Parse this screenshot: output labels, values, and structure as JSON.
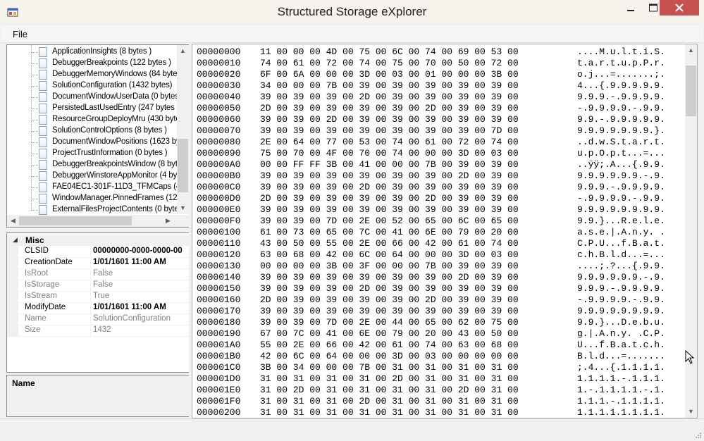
{
  "window": {
    "title": "Structured Storage eXplorer",
    "app_icon": "app-window-icon",
    "controls": [
      "minimize-icon",
      "maximize-icon",
      "close-icon"
    ],
    "close_color": "#c75050"
  },
  "menu": {
    "file": "File"
  },
  "tree": {
    "items": [
      "ApplicationInsights (8 bytes )",
      "DebuggerBreakpoints (122 bytes )",
      "DebuggerMemoryWindows (84 bytes",
      "SolutionConfiguration (1432 bytes)",
      "DocumentWindowUserData (0 bytes",
      "PersistedLastUsedEntry (247 bytes )",
      "ResourceGroupDeployMru (430 byte",
      "SolutionControlOptions (8 bytes )",
      "DocumentWindowPositions (1623 by",
      "ProjectTrustInformation (0 bytes )",
      "DebuggerBreakpointsWindow (8 byt",
      "DebuggerWinstoreAppMonitor (4 byt",
      "FAE04EC1-301F-11D3_TFMCaps (4",
      "WindowManager.PinnedFrames (12",
      "ExternalFilesProjectContents (0 bytes"
    ]
  },
  "properties": {
    "category": "Misc",
    "rows": [
      {
        "name": "CLSID",
        "value": "00000000-0000-0000-00",
        "style": "strong"
      },
      {
        "name": "CreationDate",
        "value": "1/01/1601 11:00 AM",
        "style": "strong"
      },
      {
        "name": "IsRoot",
        "value": "False",
        "style": "muted"
      },
      {
        "name": "IsStorage",
        "value": "False",
        "style": "muted"
      },
      {
        "name": "IsStream",
        "value": "True",
        "style": "muted"
      },
      {
        "name": "ModifyDate",
        "value": "1/01/1601 11:00 AM",
        "style": "strong"
      },
      {
        "name": "Name",
        "value": "SolutionConfiguration",
        "style": "muted"
      },
      {
        "name": "Size",
        "value": "1432",
        "style": "muted"
      }
    ],
    "description_title": "Name"
  },
  "hex": {
    "rows": [
      {
        "offset": "00000000",
        "bytes": "11 00 00 00 4D 00 75 00 6C 00 74 00 69 00 53 00",
        "ascii": "....M.u.l.t.i.S."
      },
      {
        "offset": "00000010",
        "bytes": "74 00 61 00 72 00 74 00 75 00 70 00 50 00 72 00",
        "ascii": "t.a.r.t.u.p.P.r."
      },
      {
        "offset": "00000020",
        "bytes": "6F 00 6A 00 00 00 3D 00 03 00 01 00 00 00 3B 00",
        "ascii": "o.j...=.......;."
      },
      {
        "offset": "00000030",
        "bytes": "34 00 00 00 7B 00 39 00 39 00 39 00 39 00 39 00",
        "ascii": "4...{.9.9.9.9.9."
      },
      {
        "offset": "00000040",
        "bytes": "39 00 39 00 39 00 2D 00 39 00 39 00 39 00 39 00",
        "ascii": "9.9.9.-.9.9.9.9."
      },
      {
        "offset": "00000050",
        "bytes": "2D 00 39 00 39 00 39 00 39 00 2D 00 39 00 39 00",
        "ascii": "-.9.9.9.9.-.9.9."
      },
      {
        "offset": "00000060",
        "bytes": "39 00 39 00 2D 00 39 00 39 00 39 00 39 00 39 00",
        "ascii": "9.9.-.9.9.9.9.9."
      },
      {
        "offset": "00000070",
        "bytes": "39 00 39 00 39 00 39 00 39 00 39 00 39 00 7D 00",
        "ascii": "9.9.9.9.9.9.9.}."
      },
      {
        "offset": "00000080",
        "bytes": "2E 00 64 00 77 00 53 00 74 00 61 00 72 00 74 00",
        "ascii": "..d.w.S.t.a.r.t."
      },
      {
        "offset": "00000090",
        "bytes": "75 00 70 00 4F 00 70 00 74 00 00 00 3D 00 03 00",
        "ascii": "u.p.O.p.t...=..."
      },
      {
        "offset": "000000A0",
        "bytes": "00 00 FF FF 3B 00 41 00 00 00 7B 00 39 00 39 00",
        "ascii": "..ÿÿ;.A...{.9.9."
      },
      {
        "offset": "000000B0",
        "bytes": "39 00 39 00 39 00 39 00 39 00 39 00 2D 00 39 00",
        "ascii": "9.9.9.9.9.9.-.9."
      },
      {
        "offset": "000000C0",
        "bytes": "39 00 39 00 39 00 2D 00 39 00 39 00 39 00 39 00",
        "ascii": "9.9.9.-.9.9.9.9."
      },
      {
        "offset": "000000D0",
        "bytes": "2D 00 39 00 39 00 39 00 39 00 2D 00 39 00 39 00",
        "ascii": "-.9.9.9.9.-.9.9."
      },
      {
        "offset": "000000E0",
        "bytes": "39 00 39 00 39 00 39 00 39 00 39 00 39 00 39 00",
        "ascii": "9.9.9.9.9.9.9.9."
      },
      {
        "offset": "000000F0",
        "bytes": "39 00 39 00 7D 00 2E 00 52 00 65 00 6C 00 65 00",
        "ascii": "9.9.}...R.e.l.e."
      },
      {
        "offset": "00000100",
        "bytes": "61 00 73 00 65 00 7C 00 41 00 6E 00 79 00 20 00",
        "ascii": "a.s.e.|.A.n.y. ."
      },
      {
        "offset": "00000110",
        "bytes": "43 00 50 00 55 00 2E 00 66 00 42 00 61 00 74 00",
        "ascii": "C.P.U...f.B.a.t."
      },
      {
        "offset": "00000120",
        "bytes": "63 00 68 00 42 00 6C 00 64 00 00 00 3D 00 03 00",
        "ascii": "c.h.B.l.d...=..."
      },
      {
        "offset": "00000130",
        "bytes": "00 00 00 00 3B 00 3F 00 00 00 7B 00 39 00 39 00",
        "ascii": "....;.?...{.9.9."
      },
      {
        "offset": "00000140",
        "bytes": "39 00 39 00 39 00 39 00 39 00 39 00 2D 00 39 00",
        "ascii": "9.9.9.9.9.9.-.9."
      },
      {
        "offset": "00000150",
        "bytes": "39 00 39 00 39 00 2D 00 39 00 39 00 39 00 39 00",
        "ascii": "9.9.9.-.9.9.9.9."
      },
      {
        "offset": "00000160",
        "bytes": "2D 00 39 00 39 00 39 00 39 00 2D 00 39 00 39 00",
        "ascii": "-.9.9.9.9.-.9.9."
      },
      {
        "offset": "00000170",
        "bytes": "39 00 39 00 39 00 39 00 39 00 39 00 39 00 39 00",
        "ascii": "9.9.9.9.9.9.9.9."
      },
      {
        "offset": "00000180",
        "bytes": "39 00 39 00 7D 00 2E 00 44 00 65 00 62 00 75 00",
        "ascii": "9.9.}...D.e.b.u."
      },
      {
        "offset": "00000190",
        "bytes": "67 00 7C 00 41 00 6E 00 79 00 20 00 43 00 50 00",
        "ascii": "g.|.A.n.y. .C.P."
      },
      {
        "offset": "000001A0",
        "bytes": "55 00 2E 00 66 00 42 00 61 00 74 00 63 00 68 00",
        "ascii": "U...f.B.a.t.c.h."
      },
      {
        "offset": "000001B0",
        "bytes": "42 00 6C 00 64 00 00 00 3D 00 03 00 00 00 00 00",
        "ascii": "B.l.d...=......."
      },
      {
        "offset": "000001C0",
        "bytes": "3B 00 34 00 00 00 7B 00 31 00 31 00 31 00 31 00",
        "ascii": ";.4...{.1.1.1.1."
      },
      {
        "offset": "000001D0",
        "bytes": "31 00 31 00 31 00 31 00 2D 00 31 00 31 00 31 00",
        "ascii": "1.1.1.1.-.1.1.1."
      },
      {
        "offset": "000001E0",
        "bytes": "31 00 2D 00 31 00 31 00 31 00 31 00 2D 00 31 00",
        "ascii": "1.-.1.1.1.1.-.1."
      },
      {
        "offset": "000001F0",
        "bytes": "31 00 31 00 31 00 2D 00 31 00 31 00 31 00 31 00",
        "ascii": "1.1.1.-.1.1.1.1."
      },
      {
        "offset": "00000200",
        "bytes": "31 00 31 00 31 00 31 00 31 00 31 00 31 00 31 00",
        "ascii": "1.1.1.1.1.1.1.1."
      }
    ]
  }
}
